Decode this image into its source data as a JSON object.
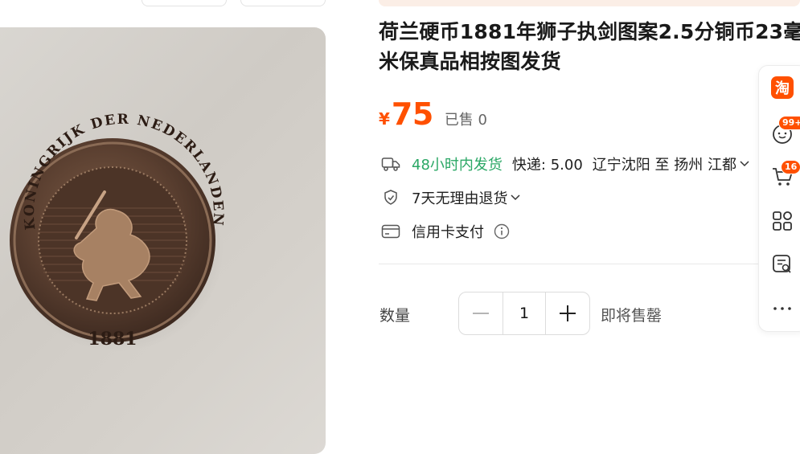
{
  "product": {
    "title": "荷兰硬币1881年狮子执剑图案2.5分铜币23毫米保真品相按图发货",
    "currency_symbol": "¥",
    "price": "75",
    "sold": "已售 0"
  },
  "shipping": {
    "dispatch": "48小时内发货",
    "express": "快递: 5.00",
    "route": "辽宁沈阳 至 扬州 江都"
  },
  "guarantee": {
    "return_policy": "7天无理由退货"
  },
  "payment": {
    "method": "信用卡支付"
  },
  "quantity": {
    "label": "数量",
    "value": "1",
    "stock_status": "即将售罄"
  },
  "sidebar": {
    "logo_text": "淘",
    "messages_badge": "99+",
    "cart_badge": "16"
  },
  "coin_image": {
    "legend": "KONINGRIJK DER NEDERLANDEN",
    "year": "1881"
  },
  "colors": {
    "accent": "#ff5000",
    "green": "#2aa765"
  },
  "icons": [
    "truck-icon",
    "shield-hand-icon",
    "credit-card-icon",
    "info-icon",
    "chevron-down-icon",
    "taobao-logo-icon",
    "message-icon",
    "cart-icon",
    "grid-icon",
    "feedback-icon",
    "more-icon"
  ]
}
